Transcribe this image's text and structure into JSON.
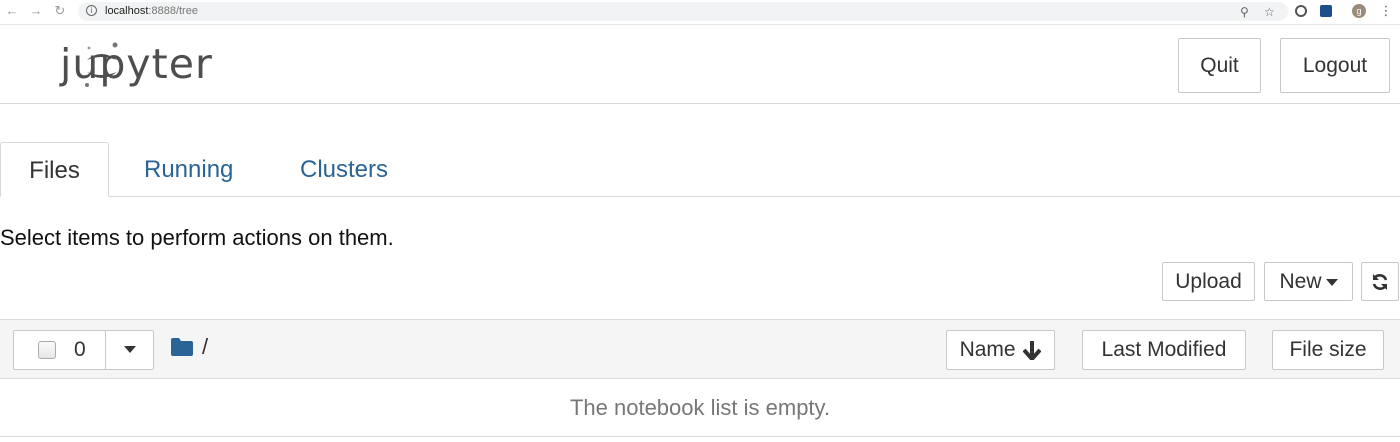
{
  "browser": {
    "back_icon": "arrow-left-icon",
    "forward_icon": "arrow-right-icon",
    "reload_icon": "reload-icon",
    "url_host": "localhost",
    "url_rest": ":8888/tree",
    "zoom_icon": "zoom-icon",
    "star_icon": "star-icon",
    "profile_initial": "g"
  },
  "header": {
    "logo_text": "jupyter",
    "quit_label": "Quit",
    "logout_label": "Logout"
  },
  "tabs": [
    {
      "label": "Files",
      "active": true
    },
    {
      "label": "Running",
      "active": false
    },
    {
      "label": "Clusters",
      "active": false
    }
  ],
  "instructions": "Select items to perform actions on them.",
  "toolbar": {
    "upload_label": "Upload",
    "new_label": "New",
    "refresh_icon": "refresh-icon"
  },
  "list": {
    "selected_count": "0",
    "path": "/",
    "columns": {
      "name": "Name",
      "last_modified": "Last Modified",
      "file_size": "File size"
    },
    "empty_message": "The notebook list is empty."
  },
  "colors": {
    "link": "#2a6496",
    "folder": "#2a6496",
    "logo_orange": "#f37726"
  }
}
